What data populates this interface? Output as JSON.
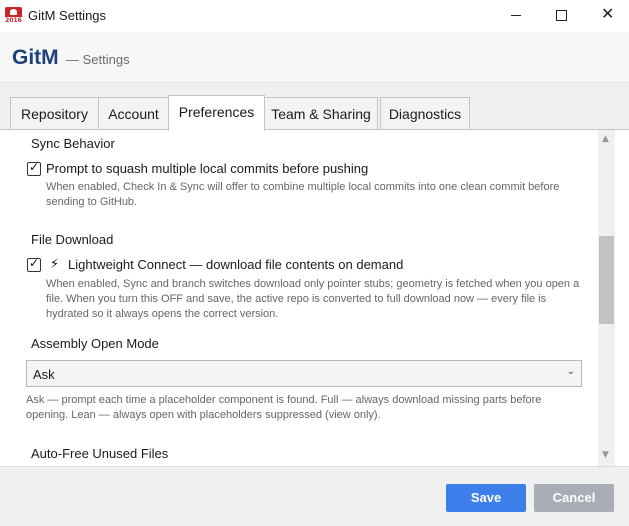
{
  "window": {
    "title": "GitM Settings",
    "app_icon": "gitm-app-icon",
    "icon_year": "2016",
    "controls": {
      "minimize": "minimize-icon",
      "maximize": "maximize-icon",
      "close": "close-icon"
    }
  },
  "header": {
    "brand": "GitM",
    "subtitle": "— Settings"
  },
  "tabs": [
    {
      "label": "Repository",
      "active": false
    },
    {
      "label": "Account",
      "active": false
    },
    {
      "label": "Preferences",
      "active": true
    },
    {
      "label": "Team & Sharing",
      "active": false
    },
    {
      "label": "Diagnostics",
      "active": false
    }
  ],
  "sync": {
    "title": "Sync Behavior",
    "option_label": "Prompt to squash multiple local commits before pushing",
    "checked": true,
    "description": "When enabled, Check In & Sync will offer to combine multiple local commits into one clean commit before sending to GitHub."
  },
  "download": {
    "title": "File Download",
    "option_label": "Lightweight Connect — download file contents on demand",
    "option_icon": "lightning-bolt-icon",
    "checked": true,
    "description": "When enabled, Sync and branch switches download only pointer stubs; geometry is fetched when you open a file. When you turn this OFF and save, the active repo is converted to full download now — every file is hydrated so it always opens the correct version."
  },
  "assembly": {
    "title": "Assembly Open Mode",
    "selected": "Ask",
    "description": "Ask  — prompt each time a placeholder component is found.   Full  — always download missing parts before opening.   Lean  — always open with placeholders suppressed (view only)."
  },
  "autofree": {
    "title": "Auto-Free Unused Files"
  },
  "footer": {
    "save_label": "Save",
    "cancel_label": "Cancel"
  },
  "colors": {
    "brand": "#1f3f7a",
    "save_button": "#3d7eea",
    "cancel_button": "#a8adb6"
  }
}
